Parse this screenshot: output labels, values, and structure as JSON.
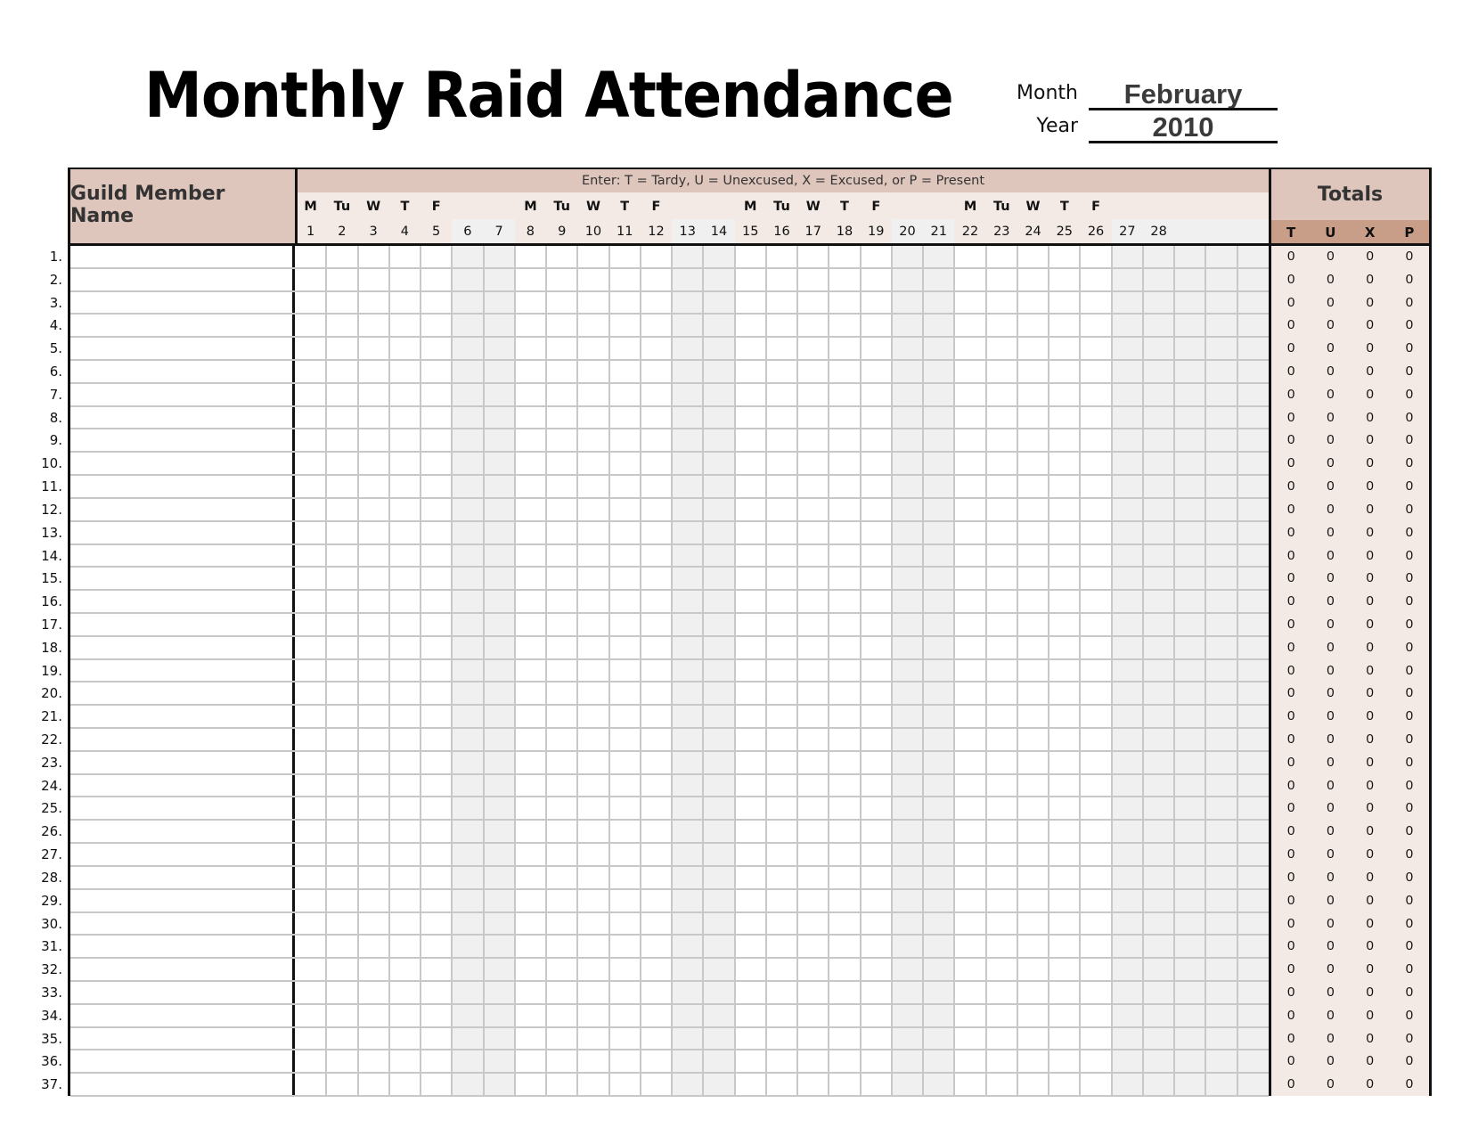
{
  "title": "Monthly Raid Attendance",
  "meta": {
    "month_label": "Month",
    "month_value": "February",
    "year_label": "Year",
    "year_value": "2010"
  },
  "table": {
    "name_header": "Guild Member Name",
    "instructions": "Enter: T = Tardy,  U = Unexcused,  X = Excused,  or P = Present",
    "totals_header": "Totals",
    "totals_columns": [
      "T",
      "U",
      "X",
      "P"
    ],
    "days": [
      {
        "dow": "M",
        "date": "1",
        "weekend": false
      },
      {
        "dow": "Tu",
        "date": "2",
        "weekend": false
      },
      {
        "dow": "W",
        "date": "3",
        "weekend": false
      },
      {
        "dow": "T",
        "date": "4",
        "weekend": false
      },
      {
        "dow": "F",
        "date": "5",
        "weekend": false
      },
      {
        "dow": "",
        "date": "6",
        "weekend": true
      },
      {
        "dow": "",
        "date": "7",
        "weekend": true
      },
      {
        "dow": "M",
        "date": "8",
        "weekend": false
      },
      {
        "dow": "Tu",
        "date": "9",
        "weekend": false
      },
      {
        "dow": "W",
        "date": "10",
        "weekend": false
      },
      {
        "dow": "T",
        "date": "11",
        "weekend": false
      },
      {
        "dow": "F",
        "date": "12",
        "weekend": false
      },
      {
        "dow": "",
        "date": "13",
        "weekend": true
      },
      {
        "dow": "",
        "date": "14",
        "weekend": true
      },
      {
        "dow": "M",
        "date": "15",
        "weekend": false
      },
      {
        "dow": "Tu",
        "date": "16",
        "weekend": false
      },
      {
        "dow": "W",
        "date": "17",
        "weekend": false
      },
      {
        "dow": "T",
        "date": "18",
        "weekend": false
      },
      {
        "dow": "F",
        "date": "19",
        "weekend": false
      },
      {
        "dow": "",
        "date": "20",
        "weekend": true
      },
      {
        "dow": "",
        "date": "21",
        "weekend": true
      },
      {
        "dow": "M",
        "date": "22",
        "weekend": false
      },
      {
        "dow": "Tu",
        "date": "23",
        "weekend": false
      },
      {
        "dow": "W",
        "date": "24",
        "weekend": false
      },
      {
        "dow": "T",
        "date": "25",
        "weekend": false
      },
      {
        "dow": "F",
        "date": "26",
        "weekend": false
      },
      {
        "dow": "",
        "date": "27",
        "weekend": true
      },
      {
        "dow": "",
        "date": "28",
        "weekend": true
      },
      {
        "dow": "",
        "date": "",
        "weekend": true
      },
      {
        "dow": "",
        "date": "",
        "weekend": true
      },
      {
        "dow": "",
        "date": "",
        "weekend": true
      }
    ],
    "rows": [
      {
        "num": "1.",
        "name": "",
        "totals": [
          "0",
          "0",
          "0",
          "0"
        ]
      },
      {
        "num": "2.",
        "name": "",
        "totals": [
          "0",
          "0",
          "0",
          "0"
        ]
      },
      {
        "num": "3.",
        "name": "",
        "totals": [
          "0",
          "0",
          "0",
          "0"
        ]
      },
      {
        "num": "4.",
        "name": "",
        "totals": [
          "0",
          "0",
          "0",
          "0"
        ]
      },
      {
        "num": "5.",
        "name": "",
        "totals": [
          "0",
          "0",
          "0",
          "0"
        ]
      },
      {
        "num": "6.",
        "name": "",
        "totals": [
          "0",
          "0",
          "0",
          "0"
        ]
      },
      {
        "num": "7.",
        "name": "",
        "totals": [
          "0",
          "0",
          "0",
          "0"
        ]
      },
      {
        "num": "8.",
        "name": "",
        "totals": [
          "0",
          "0",
          "0",
          "0"
        ]
      },
      {
        "num": "9.",
        "name": "",
        "totals": [
          "0",
          "0",
          "0",
          "0"
        ]
      },
      {
        "num": "10.",
        "name": "",
        "totals": [
          "0",
          "0",
          "0",
          "0"
        ]
      },
      {
        "num": "11.",
        "name": "",
        "totals": [
          "0",
          "0",
          "0",
          "0"
        ]
      },
      {
        "num": "12.",
        "name": "",
        "totals": [
          "0",
          "0",
          "0",
          "0"
        ]
      },
      {
        "num": "13.",
        "name": "",
        "totals": [
          "0",
          "0",
          "0",
          "0"
        ]
      },
      {
        "num": "14.",
        "name": "",
        "totals": [
          "0",
          "0",
          "0",
          "0"
        ]
      },
      {
        "num": "15.",
        "name": "",
        "totals": [
          "0",
          "0",
          "0",
          "0"
        ]
      },
      {
        "num": "16.",
        "name": "",
        "totals": [
          "0",
          "0",
          "0",
          "0"
        ]
      },
      {
        "num": "17.",
        "name": "",
        "totals": [
          "0",
          "0",
          "0",
          "0"
        ]
      },
      {
        "num": "18.",
        "name": "",
        "totals": [
          "0",
          "0",
          "0",
          "0"
        ]
      },
      {
        "num": "19.",
        "name": "",
        "totals": [
          "0",
          "0",
          "0",
          "0"
        ]
      },
      {
        "num": "20.",
        "name": "",
        "totals": [
          "0",
          "0",
          "0",
          "0"
        ]
      },
      {
        "num": "21.",
        "name": "",
        "totals": [
          "0",
          "0",
          "0",
          "0"
        ]
      },
      {
        "num": "22.",
        "name": "",
        "totals": [
          "0",
          "0",
          "0",
          "0"
        ]
      },
      {
        "num": "23.",
        "name": "",
        "totals": [
          "0",
          "0",
          "0",
          "0"
        ]
      },
      {
        "num": "24.",
        "name": "",
        "totals": [
          "0",
          "0",
          "0",
          "0"
        ]
      },
      {
        "num": "25.",
        "name": "",
        "totals": [
          "0",
          "0",
          "0",
          "0"
        ]
      },
      {
        "num": "26.",
        "name": "",
        "totals": [
          "0",
          "0",
          "0",
          "0"
        ]
      },
      {
        "num": "27.",
        "name": "",
        "totals": [
          "0",
          "0",
          "0",
          "0"
        ]
      },
      {
        "num": "28.",
        "name": "",
        "totals": [
          "0",
          "0",
          "0",
          "0"
        ]
      },
      {
        "num": "29.",
        "name": "",
        "totals": [
          "0",
          "0",
          "0",
          "0"
        ]
      },
      {
        "num": "30.",
        "name": "",
        "totals": [
          "0",
          "0",
          "0",
          "0"
        ]
      },
      {
        "num": "31.",
        "name": "",
        "totals": [
          "0",
          "0",
          "0",
          "0"
        ]
      },
      {
        "num": "32.",
        "name": "",
        "totals": [
          "0",
          "0",
          "0",
          "0"
        ]
      },
      {
        "num": "33.",
        "name": "",
        "totals": [
          "0",
          "0",
          "0",
          "0"
        ]
      },
      {
        "num": "34.",
        "name": "",
        "totals": [
          "0",
          "0",
          "0",
          "0"
        ]
      },
      {
        "num": "35.",
        "name": "",
        "totals": [
          "0",
          "0",
          "0",
          "0"
        ]
      },
      {
        "num": "36.",
        "name": "",
        "totals": [
          "0",
          "0",
          "0",
          "0"
        ]
      },
      {
        "num": "37.",
        "name": "",
        "totals": [
          "0",
          "0",
          "0",
          "0"
        ]
      }
    ]
  },
  "colors": {
    "header_bg": "#dfc6bc",
    "header_light_bg": "#f3e9e5",
    "totals_subheader_bg": "#c99e88",
    "weekend_bg": "#f0f0f0",
    "gridline": "#c8c8c8"
  }
}
